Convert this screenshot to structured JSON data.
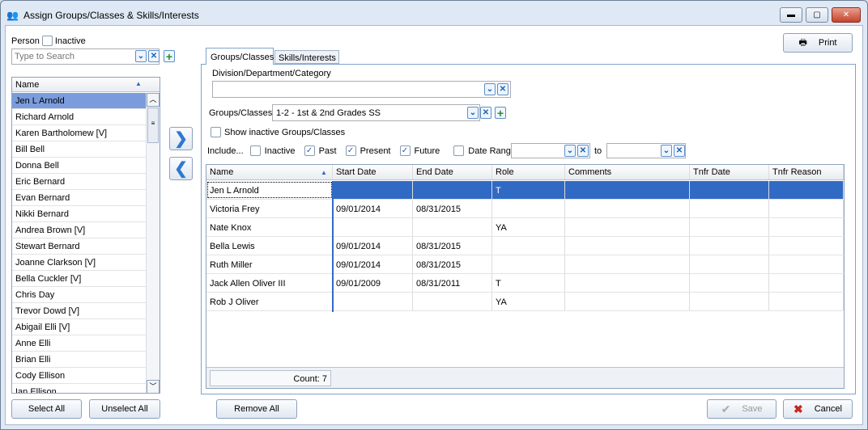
{
  "window": {
    "title": "Assign Groups/Classes & Skills/Interests",
    "minimize": "▬",
    "maximize": "▢",
    "close": "✕"
  },
  "person": {
    "label": "Person",
    "inactive_label": "Inactive",
    "search_placeholder": "Type to Search"
  },
  "list": {
    "header": "Name",
    "items": [
      "Jen L Arnold",
      "Richard Arnold",
      "Karen Bartholomew [V]",
      "Bill Bell",
      "Donna Bell",
      "Eric Bernard",
      "Evan Bernard",
      "Nikki Bernard",
      "Andrea Brown [V]",
      "Stewart Bernard",
      "Joanne Clarkson [V]",
      "Bella Cuckler [V]",
      "Chris Day",
      "Trevor Dowd [V]",
      "Abigail Elli [V]",
      "Anne Elli",
      "Brian Elli",
      "Cody Ellison",
      "Ian Ellison"
    ]
  },
  "buttons": {
    "select_all": "Select All",
    "unselect_all": "Unselect All",
    "remove_all": "Remove All",
    "print": "Print",
    "save": "Save",
    "cancel": "Cancel"
  },
  "tabs": [
    "Groups/Classes",
    "Skills/Interests"
  ],
  "form": {
    "division_label": "Division/Department/Category",
    "division_value": "",
    "groups_label": "Groups/Classes",
    "groups_value": "1-2 - 1st & 2nd Grades SS",
    "show_inactive_label": "Show inactive Groups/Classes",
    "include_label": "Include...",
    "include": [
      {
        "label": "Inactive",
        "checked": false
      },
      {
        "label": "Past",
        "checked": true
      },
      {
        "label": "Present",
        "checked": true
      },
      {
        "label": "Future",
        "checked": true
      }
    ],
    "date_range_label": "Date Range",
    "to_label": "to"
  },
  "grid": {
    "columns": [
      "Name",
      "Start Date",
      "End Date",
      "Role",
      "Comments",
      "Tnfr Date",
      "Tnfr Reason"
    ],
    "rows": [
      [
        "Jen L Arnold",
        "",
        "",
        "T",
        "",
        "",
        ""
      ],
      [
        "Victoria Frey",
        "09/01/2014",
        "08/31/2015",
        "",
        "",
        "",
        ""
      ],
      [
        "Nate Knox",
        "",
        "",
        "YA",
        "",
        "",
        ""
      ],
      [
        "Bella Lewis",
        "09/01/2014",
        "08/31/2015",
        "",
        "",
        "",
        ""
      ],
      [
        "Ruth Miller",
        "09/01/2014",
        "08/31/2015",
        "",
        "",
        "",
        ""
      ],
      [
        "Jack Allen Oliver III",
        "09/01/2009",
        "08/31/2011",
        "T",
        "",
        "",
        ""
      ],
      [
        "Rob J Oliver",
        "",
        "",
        "YA",
        "",
        "",
        ""
      ]
    ],
    "count": "Count: 7"
  },
  "colors": {
    "selected": "#316ac5",
    "list_selected": "#7b9cdc"
  }
}
